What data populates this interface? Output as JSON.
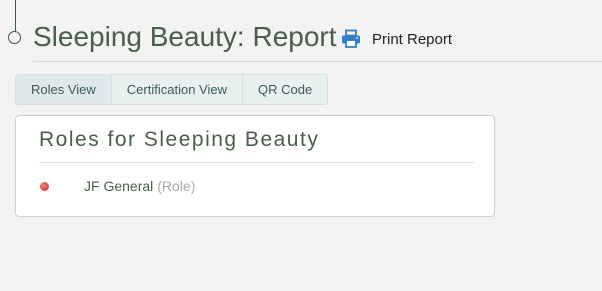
{
  "header": {
    "title": "Sleeping Beauty: Report",
    "print_label": "Print Report"
  },
  "tabs": [
    {
      "label": "Roles View",
      "active": true
    },
    {
      "label": "Certification View",
      "active": false
    },
    {
      "label": "QR Code",
      "active": false
    }
  ],
  "panel": {
    "title": "Roles for Sleeping Beauty",
    "roles": [
      {
        "name": "JF General",
        "type": "(Role)",
        "status_color": "#e04848"
      }
    ]
  },
  "colors": {
    "accent": "#4a5f4a",
    "print_icon": "#2f7ec7",
    "page_background": "#f3f3f3"
  },
  "icons": {
    "print": "printer-icon",
    "role_bullet": "status-dot-icon",
    "timeline": "timeline-node-icon"
  }
}
